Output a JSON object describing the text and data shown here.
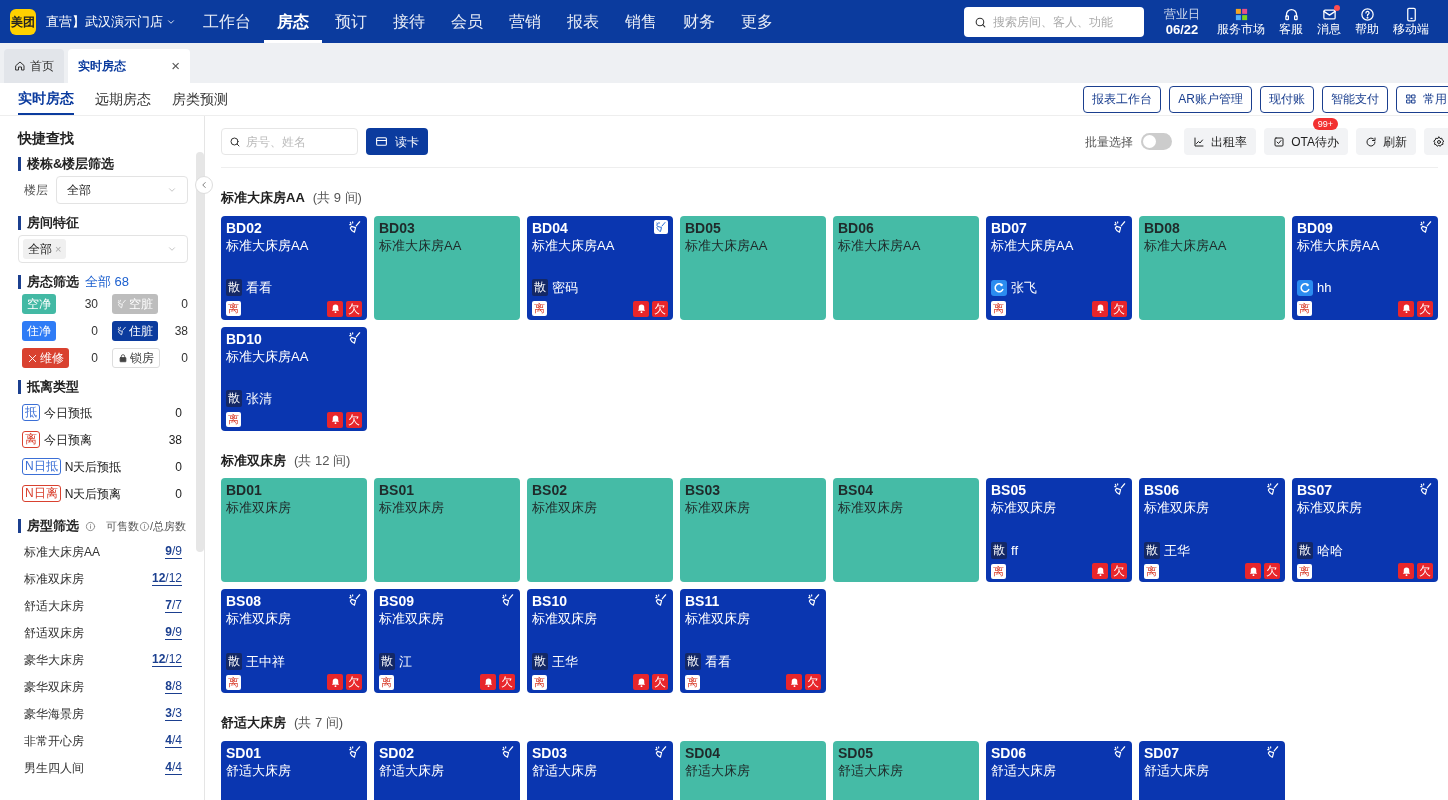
{
  "top_nav": {
    "logo": "美团",
    "store": "直营】武汉演示门店",
    "menu": [
      {
        "label": "工作台",
        "selected": false
      },
      {
        "label": "房态",
        "selected": true
      },
      {
        "label": "预订",
        "selected": false
      },
      {
        "label": "接待",
        "selected": false
      },
      {
        "label": "会员",
        "selected": false
      },
      {
        "label": "营销",
        "selected": false
      },
      {
        "label": "报表",
        "selected": false
      },
      {
        "label": "销售",
        "selected": false
      },
      {
        "label": "财务",
        "selected": false
      },
      {
        "label": "更多",
        "selected": false
      }
    ],
    "search_placeholder": "搜索房间、客人、功能",
    "date_label": "营业日",
    "date": "06/22",
    "tools": [
      {
        "kind": "apps",
        "label": "服务市场",
        "dot": false
      },
      {
        "kind": "headset",
        "label": "客服",
        "dot": false
      },
      {
        "kind": "mail",
        "label": "消息",
        "dot": true
      },
      {
        "kind": "help",
        "label": "帮助",
        "dot": false
      },
      {
        "kind": "phone",
        "label": "移动端",
        "dot": false
      }
    ]
  },
  "page_tabs": [
    {
      "kind": "home",
      "label": "首页",
      "selected": false
    },
    {
      "kind": "page",
      "label": "实时房态",
      "selected": true,
      "close": "×"
    }
  ],
  "view_tabs": [
    {
      "label": "实时房态",
      "selected": true
    },
    {
      "label": "远期房态",
      "selected": false
    },
    {
      "label": "房类预测",
      "selected": false
    }
  ],
  "actions": [
    {
      "label": "报表工作台",
      "kind": "text"
    },
    {
      "label": "AR账户管理",
      "kind": "text"
    },
    {
      "label": "现付账",
      "kind": "text"
    },
    {
      "label": "智能支付",
      "kind": "text"
    },
    {
      "label": "常用",
      "kind": "grid"
    }
  ],
  "sidebar": {
    "title": "快捷查找",
    "floor_filter": {
      "heading": "楼栋&楼层筛选",
      "label": "楼层",
      "value": "全部"
    },
    "features": {
      "heading": "房间特征",
      "tag": "全部",
      "remove": "×"
    },
    "status_filter": {
      "heading": "房态筛选",
      "total": "全部 68",
      "items": [
        {
          "kind": "vacant_clean",
          "label": "空净",
          "count": "30"
        },
        {
          "kind": "vacant_dirty",
          "label": "空脏",
          "count": "0"
        },
        {
          "kind": "occupied_clean",
          "label": "住净",
          "count": "0"
        },
        {
          "kind": "occupied_dirty",
          "label": "住脏",
          "count": "38"
        },
        {
          "kind": "repair",
          "label": "维修",
          "count": "0"
        },
        {
          "kind": "locked",
          "label": "锁房",
          "count": "0"
        }
      ]
    },
    "arrival_types": {
      "heading": "抵离类型",
      "items": [
        {
          "badge": "抵",
          "label": "今日预抵",
          "count": "0",
          "color": "#3b6fd6"
        },
        {
          "badge": "离",
          "label": "今日预离",
          "count": "38",
          "color": "#d9412f"
        },
        {
          "badge": "N日抵",
          "label": "N天后预抵",
          "count": "0",
          "color": "#3b6fd6"
        },
        {
          "badge": "N日离",
          "label": "N天后预离",
          "count": "0",
          "color": "#d9412f"
        }
      ]
    },
    "room_types": {
      "heading": "房型筛选",
      "columns": "可售数",
      "columns_tail": "/总房数",
      "items": [
        {
          "name": "标准大床房AA",
          "count": "**9**/9"
        },
        {
          "name": "标准双床房",
          "count": "**12**/12"
        },
        {
          "name": "舒适大床房",
          "count": "**7**/7"
        },
        {
          "name": "舒适双床房",
          "count": "**9**/9"
        },
        {
          "name": "豪华大床房",
          "count": "**12**/12"
        },
        {
          "name": "豪华双床房",
          "count": "**8**/8"
        },
        {
          "name": "豪华海景房",
          "count": "**3**/3"
        },
        {
          "name": "非常开心房",
          "count": "**4**/4"
        },
        {
          "name": "男生四人间",
          "count": "**4**/4"
        }
      ]
    }
  },
  "toolbar": {
    "search_placeholder": "房号、姓名",
    "read_card": "读卡",
    "batch_label": "批量选择",
    "batch_on": false,
    "buttons": [
      {
        "kind": "chart",
        "label": "出租率"
      },
      {
        "kind": "check",
        "label": "OTA待办",
        "badge": "99+"
      },
      {
        "kind": "refresh",
        "label": "刷新"
      },
      {
        "kind": "settings"
      }
    ]
  },
  "groups": [
    {
      "title": "标准大床房AA",
      "count": "(共 9 间)",
      "rooms": [
        {
          "number": "BD02",
          "type": "标准大床房AA",
          "kind": "occupied",
          "dirty": true,
          "icon_boxed": false,
          "ota": false,
          "source_label": "散",
          "guest": "看看",
          "depart": "离",
          "owe": "欠"
        },
        {
          "number": "BD03",
          "type": "标准大床房AA",
          "kind": "vacant",
          "dirty": false
        },
        {
          "number": "BD04",
          "type": "标准大床房AA",
          "kind": "occupied",
          "dirty": true,
          "icon_boxed": true,
          "ota": false,
          "source_label": "散",
          "guest": "密码",
          "depart": "离",
          "owe": "欠"
        },
        {
          "number": "BD05",
          "type": "标准大床房AA",
          "kind": "vacant",
          "dirty": false
        },
        {
          "number": "BD06",
          "type": "标准大床房AA",
          "kind": "vacant",
          "dirty": false
        },
        {
          "number": "BD07",
          "type": "标准大床房AA",
          "kind": "occupied",
          "dirty": true,
          "icon_boxed": false,
          "ota": true,
          "guest": "张飞",
          "depart": "离",
          "owe": "欠"
        },
        {
          "number": "BD08",
          "type": "标准大床房AA",
          "kind": "vacant",
          "dirty": false
        },
        {
          "number": "BD09",
          "type": "标准大床房AA",
          "kind": "occupied",
          "dirty": true,
          "icon_boxed": false,
          "ota": true,
          "guest": "hh",
          "depart": "离",
          "owe": "欠"
        },
        {
          "number": "BD10",
          "type": "标准大床房AA",
          "kind": "occupied",
          "dirty": true,
          "icon_boxed": false,
          "ota": false,
          "source_label": "散",
          "guest": "张清",
          "depart": "离",
          "owe": "欠"
        }
      ]
    },
    {
      "title": "标准双床房",
      "count": "(共 12 间)",
      "rooms": [
        {
          "number": "BD01",
          "type": "标准双床房",
          "kind": "vacant",
          "dirty": false
        },
        {
          "number": "BS01",
          "type": "标准双床房",
          "kind": "vacant",
          "dirty": false
        },
        {
          "number": "BS02",
          "type": "标准双床房",
          "kind": "vacant",
          "dirty": false
        },
        {
          "number": "BS03",
          "type": "标准双床房",
          "kind": "vacant",
          "dirty": false
        },
        {
          "number": "BS04",
          "type": "标准双床房",
          "kind": "vacant",
          "dirty": false
        },
        {
          "number": "BS05",
          "type": "标准双床房",
          "kind": "occupied",
          "dirty": true,
          "icon_boxed": false,
          "ota": false,
          "source_label": "散",
          "guest": "ff",
          "depart": "离",
          "owe": "欠"
        },
        {
          "number": "BS06",
          "type": "标准双床房",
          "kind": "occupied",
          "dirty": true,
          "icon_boxed": false,
          "ota": false,
          "source_label": "散",
          "guest": "王华",
          "depart": "离",
          "owe": "欠"
        },
        {
          "number": "BS07",
          "type": "标准双床房",
          "kind": "occupied",
          "dirty": true,
          "icon_boxed": false,
          "ota": false,
          "source_label": "散",
          "guest": "哈哈",
          "depart": "离",
          "owe": "欠"
        },
        {
          "number": "BS08",
          "type": "标准双床房",
          "kind": "occupied",
          "dirty": true,
          "icon_boxed": false,
          "ota": false,
          "source_label": "散",
          "guest": "王中祥",
          "depart": "离",
          "owe": "欠"
        },
        {
          "number": "BS09",
          "type": "标准双床房",
          "kind": "occupied",
          "dirty": true,
          "icon_boxed": false,
          "ota": false,
          "source_label": "散",
          "guest": "江",
          "depart": "离",
          "owe": "欠"
        },
        {
          "number": "BS10",
          "type": "标准双床房",
          "kind": "occupied",
          "dirty": true,
          "icon_boxed": false,
          "ota": false,
          "source_label": "散",
          "guest": "王华",
          "depart": "离",
          "owe": "欠"
        },
        {
          "number": "BS11",
          "type": "标准双床房",
          "kind": "occupied",
          "dirty": true,
          "icon_boxed": false,
          "ota": false,
          "source_label": "散",
          "guest": "看看",
          "depart": "离",
          "owe": "欠"
        }
      ]
    },
    {
      "title": "舒适大床房",
      "count": "(共 7 间)",
      "rooms": [
        {
          "number": "SD01",
          "type": "舒适大床房",
          "kind": "occupied",
          "dirty": true,
          "icon_boxed": false
        },
        {
          "number": "SD02",
          "type": "舒适大床房",
          "kind": "occupied",
          "dirty": true,
          "icon_boxed": false
        },
        {
          "number": "SD03",
          "type": "舒适大床房",
          "kind": "occupied",
          "dirty": true,
          "icon_boxed": false
        },
        {
          "number": "SD04",
          "type": "舒适大床房",
          "kind": "vacant",
          "dirty": false
        },
        {
          "number": "SD05",
          "type": "舒适大床房",
          "kind": "vacant",
          "dirty": false
        },
        {
          "number": "SD06",
          "type": "舒适大床房",
          "kind": "occupied",
          "dirty": true,
          "icon_boxed": false
        },
        {
          "number": "SD07",
          "type": "舒适大床房",
          "kind": "occupied",
          "dirty": true,
          "icon_boxed": false
        }
      ]
    }
  ]
}
